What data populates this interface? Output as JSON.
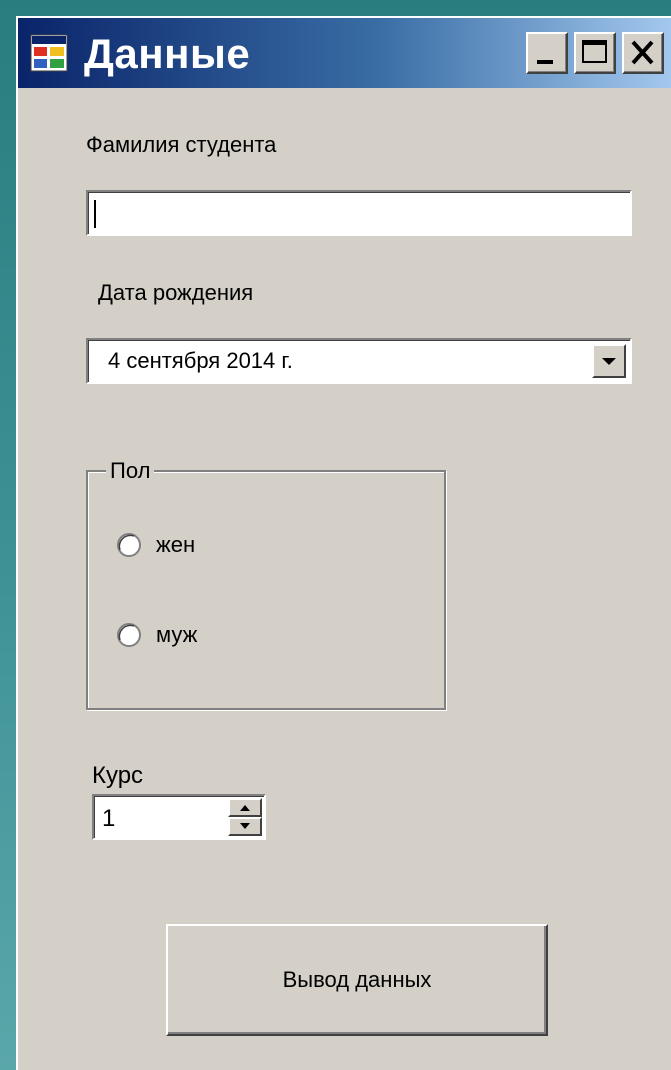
{
  "window": {
    "title": "Данные",
    "controls": {
      "minimize": "minimize",
      "maximize": "maximize",
      "close": "close"
    }
  },
  "form": {
    "surname_label": "Фамилия студента",
    "surname_value": "",
    "birth_label": "Дата рождения",
    "birth_value": "4 сентября 2014 г.",
    "gender_group_label": "Пол",
    "gender_options": [
      {
        "label": "жен",
        "checked": false
      },
      {
        "label": "муж",
        "checked": false
      }
    ],
    "course_label": "Курс",
    "course_value": "1",
    "submit_label": "Вывод данных"
  },
  "icons": {
    "app": "app-window-icon",
    "dropdown": "chevron-down-icon",
    "spin_up": "spin-up-icon",
    "spin_down": "spin-down-icon"
  },
  "colors": {
    "title_gradient_start": "#0a246a",
    "title_gradient_end": "#a6caf0",
    "face": "#d4d0c8",
    "desktop": "#2a7d7e"
  }
}
